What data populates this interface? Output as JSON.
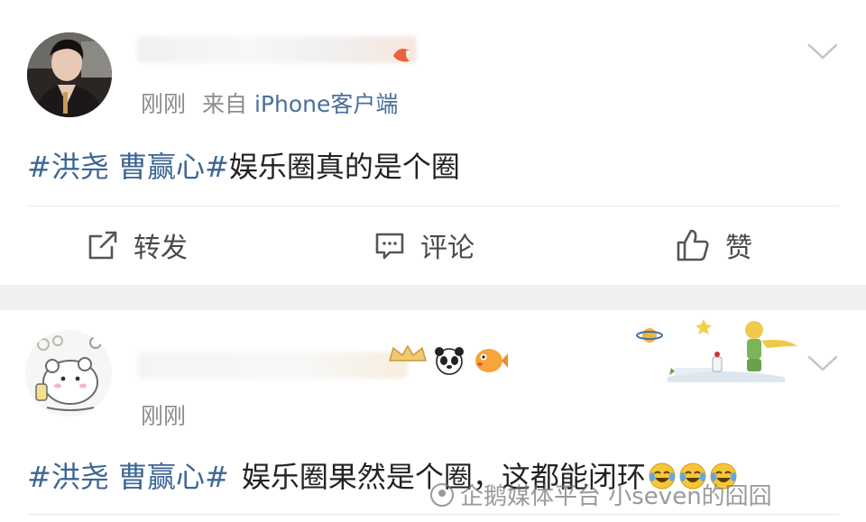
{
  "posts": [
    {
      "time": "刚刚",
      "source_prefix": "来自",
      "source_name": "iPhone客户端",
      "topic": "#洪尧 曹赢心#",
      "text": "娱乐圈真的是个圈",
      "actions": {
        "repost": "转发",
        "comment": "评论",
        "like": "赞"
      }
    },
    {
      "time": "刚刚",
      "topic": "#洪尧 曹赢心#",
      "text": "娱乐圈果然是个圈，这都能闭环",
      "emoji_icons": [
        "crying-laughing-emoji",
        "crying-laughing-emoji",
        "crying-laughing-emoji"
      ]
    }
  ],
  "watermark": "企鹅媒体平台 小seven的囧囧",
  "colors": {
    "topic": "#3c6694",
    "meta": "#8c8c8c",
    "separator": "#f0f0f0"
  }
}
